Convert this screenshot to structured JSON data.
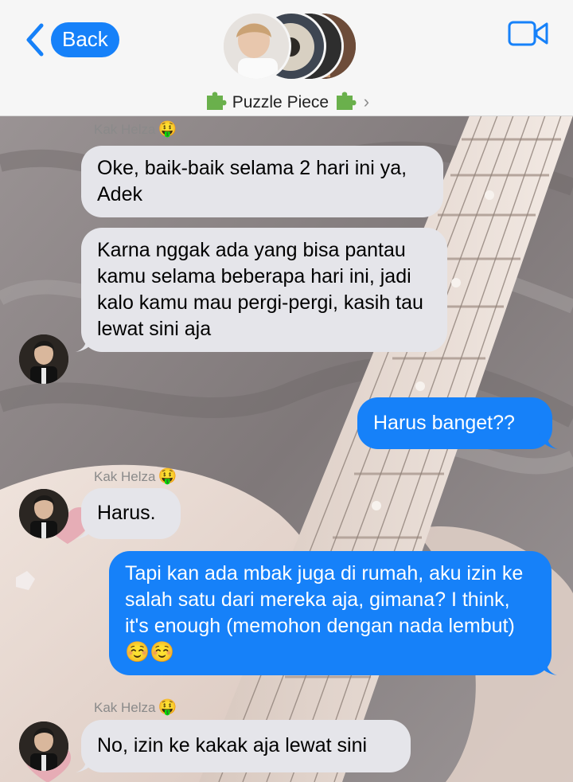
{
  "header": {
    "back_label": "Back",
    "group_name": "Puzzle Piece",
    "group_emoji": "puzzle-piece-icon",
    "video_icon": "video-camera-icon",
    "accent": "#1681f9"
  },
  "messages": [
    {
      "type": "in",
      "sender": "Kak Helza",
      "sender_emoji": "🤑",
      "text": "Oke, baik-baik selama 2 hari ini ya, Adek"
    },
    {
      "type": "in",
      "text": "Karna nggak ada yang bisa pantau kamu selama beberapa hari ini, jadi kalo kamu mau pergi-pergi, kasih tau lewat sini aja"
    },
    {
      "type": "out",
      "text": "Harus banget??"
    },
    {
      "type": "in",
      "sender": "Kak Helza",
      "sender_emoji": "🤑",
      "text": "Harus."
    },
    {
      "type": "out",
      "text": "Tapi kan ada mbak juga di rumah, aku izin ke salah satu dari mereka aja, gimana? I think, it's enough (memohon dengan nada lembut) ☺️☺️"
    },
    {
      "type": "in",
      "sender": "Kak Helza",
      "sender_emoji": "🤑",
      "text": "No, izin ke kakak aja lewat sini"
    }
  ],
  "colors": {
    "incoming_bubble": "#e5e5ea",
    "outgoing_bubble": "#1681f9"
  }
}
